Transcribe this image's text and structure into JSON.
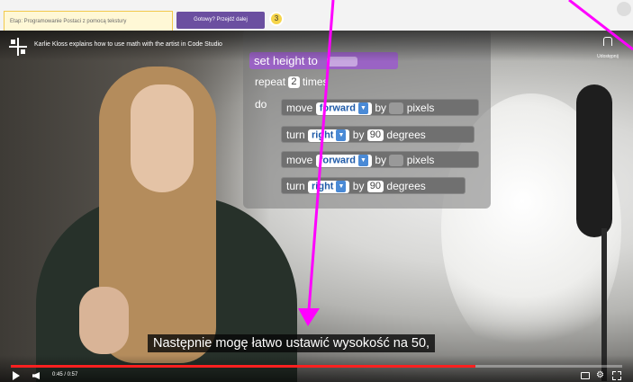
{
  "top_bar": {
    "tab_text": "Etap: Programowanie Postaci z pomocą tekstury",
    "next_button_label": "Gotowy? Przejdź dalej",
    "step_number": "3"
  },
  "video": {
    "title": "Karlie Kloss explains how to use math with the artist in Code Studio",
    "share_label": "Udostępnij",
    "subtitle": "Następnie mogę łatwo ustawić wysokość na 50,",
    "time": "0:45 / 0:57",
    "progress": 0.76,
    "code_blocks": {
      "set_label": "set height to",
      "repeat_label": "repeat",
      "repeat_count": "2",
      "repeat_suffix": "times",
      "do_label": "do",
      "cmd1_a": "move",
      "cmd1_dd": "forward",
      "cmd1_b": "by",
      "cmd1_c": "pixels",
      "cmd2_a": "turn",
      "cmd2_dd": "right",
      "cmd2_b": "by",
      "cmd2_num": "90",
      "cmd2_c": "degrees",
      "cmd3_a": "move",
      "cmd3_dd": "forward",
      "cmd3_b": "by",
      "cmd3_c": "pixels",
      "cmd4_a": "turn",
      "cmd4_dd": "right",
      "cmd4_b": "by",
      "cmd4_num": "90",
      "cmd4_c": "degrees"
    }
  },
  "colors": {
    "annotation_arrow": "#ff00ff",
    "progress": "#ff2020",
    "set_block": "#9a63c4",
    "next_button": "#6b4fa0"
  },
  "icons": [
    "logo-icon",
    "share-icon",
    "play-icon",
    "volume-icon",
    "captions-icon",
    "gear-icon",
    "fullscreen-icon"
  ]
}
